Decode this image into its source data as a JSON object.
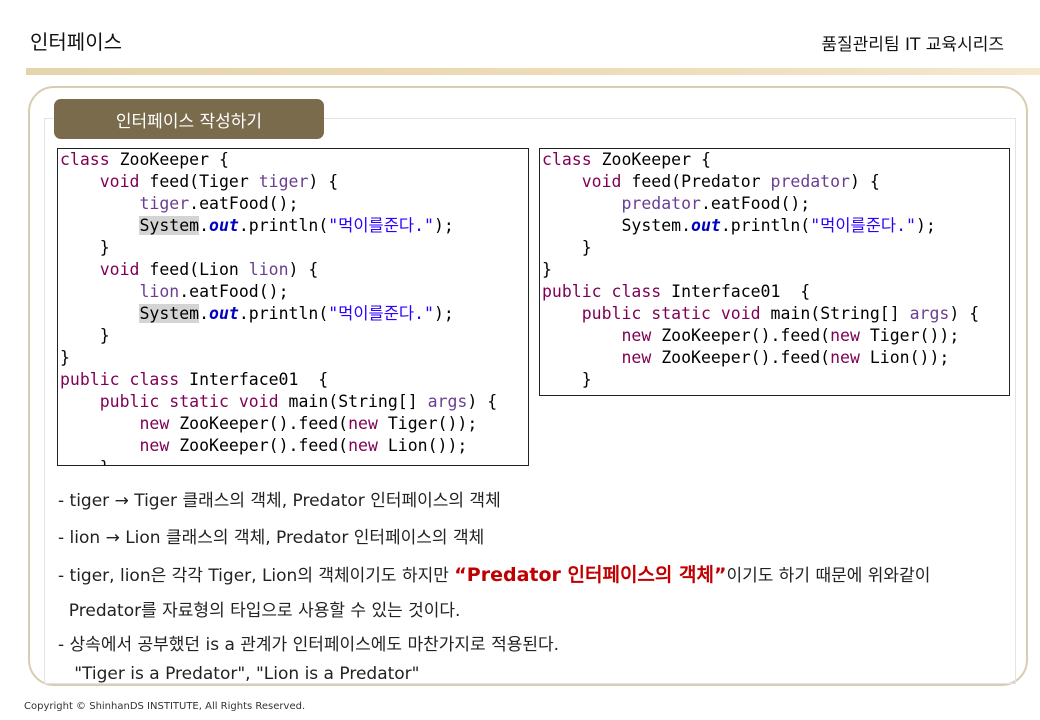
{
  "header": {
    "title": "인터페이스",
    "series": "품질관리팀 IT 교육시리즈"
  },
  "section": {
    "tab_label": "인터페이스 작성하기"
  },
  "code_left": {
    "lines": [
      [
        {
          "t": "class",
          "c": "kw"
        },
        {
          "t": " ZooKeeper {"
        }
      ],
      [
        {
          "t": "    "
        },
        {
          "t": "void",
          "c": "kw"
        },
        {
          "t": " feed(Tiger "
        },
        {
          "t": "tiger",
          "c": "var"
        },
        {
          "t": ") {"
        }
      ],
      [
        {
          "t": "        "
        },
        {
          "t": "tiger",
          "c": "var"
        },
        {
          "t": ".eatFood();"
        }
      ],
      [
        {
          "t": "        "
        },
        {
          "t": "System",
          "c": "hl"
        },
        {
          "t": "."
        },
        {
          "t": "out",
          "c": "field"
        },
        {
          "t": ".println("
        },
        {
          "t": "\"먹이를준다.\"",
          "c": "str"
        },
        {
          "t": ");"
        }
      ],
      [
        {
          "t": "    }"
        }
      ],
      [
        {
          "t": "    "
        },
        {
          "t": "void",
          "c": "kw"
        },
        {
          "t": " feed(Lion "
        },
        {
          "t": "lion",
          "c": "var"
        },
        {
          "t": ") {"
        }
      ],
      [
        {
          "t": "        "
        },
        {
          "t": "lion",
          "c": "var"
        },
        {
          "t": ".eatFood();"
        }
      ],
      [
        {
          "t": "        "
        },
        {
          "t": "System",
          "c": "hl"
        },
        {
          "t": "."
        },
        {
          "t": "out",
          "c": "field"
        },
        {
          "t": ".println("
        },
        {
          "t": "\"먹이를준다.\"",
          "c": "str"
        },
        {
          "t": ");"
        }
      ],
      [
        {
          "t": "    }"
        }
      ],
      [
        {
          "t": "}"
        }
      ],
      [
        {
          "t": "public",
          "c": "kw"
        },
        {
          "t": " "
        },
        {
          "t": "class",
          "c": "kw"
        },
        {
          "t": " Interface01  {"
        }
      ],
      [
        {
          "t": "    "
        },
        {
          "t": "public",
          "c": "kw"
        },
        {
          "t": " "
        },
        {
          "t": "static",
          "c": "kw"
        },
        {
          "t": " "
        },
        {
          "t": "void",
          "c": "kw"
        },
        {
          "t": " main(String[] "
        },
        {
          "t": "args",
          "c": "var"
        },
        {
          "t": ") {"
        }
      ],
      [
        {
          "t": "        "
        },
        {
          "t": "new",
          "c": "kw"
        },
        {
          "t": " ZooKeeper().feed("
        },
        {
          "t": "new",
          "c": "kw"
        },
        {
          "t": " Tiger());"
        }
      ],
      [
        {
          "t": "        "
        },
        {
          "t": "new",
          "c": "kw"
        },
        {
          "t": " ZooKeeper().feed("
        },
        {
          "t": "new",
          "c": "kw"
        },
        {
          "t": " Lion());"
        }
      ],
      [
        {
          "t": "    }"
        }
      ]
    ]
  },
  "code_right": {
    "lines": [
      [
        {
          "t": "class",
          "c": "kw"
        },
        {
          "t": " ZooKeeper {"
        }
      ],
      [
        {
          "t": "    "
        },
        {
          "t": "void",
          "c": "kw"
        },
        {
          "t": " feed(Predator "
        },
        {
          "t": "predator",
          "c": "var"
        },
        {
          "t": ") {"
        }
      ],
      [
        {
          "t": "        "
        },
        {
          "t": "predator",
          "c": "var"
        },
        {
          "t": ".eatFood();"
        }
      ],
      [
        {
          "t": "        System."
        },
        {
          "t": "out",
          "c": "field"
        },
        {
          "t": ".println("
        },
        {
          "t": "\"먹이를준다.\"",
          "c": "str"
        },
        {
          "t": ");"
        }
      ],
      [
        {
          "t": "    }"
        }
      ],
      [
        {
          "t": "}"
        }
      ],
      [
        {
          "t": "public",
          "c": "kw"
        },
        {
          "t": " "
        },
        {
          "t": "class",
          "c": "kw"
        },
        {
          "t": " Interface01  {"
        }
      ],
      [
        {
          "t": "    "
        },
        {
          "t": "public",
          "c": "kw"
        },
        {
          "t": " "
        },
        {
          "t": "static",
          "c": "kw"
        },
        {
          "t": " "
        },
        {
          "t": "void",
          "c": "kw"
        },
        {
          "t": " main(String[] "
        },
        {
          "t": "args",
          "c": "var"
        },
        {
          "t": ") {"
        }
      ],
      [
        {
          "t": "        "
        },
        {
          "t": "new",
          "c": "kw"
        },
        {
          "t": " ZooKeeper().feed("
        },
        {
          "t": "new",
          "c": "kw"
        },
        {
          "t": " Tiger());"
        }
      ],
      [
        {
          "t": "        "
        },
        {
          "t": "new",
          "c": "kw"
        },
        {
          "t": " ZooKeeper().feed("
        },
        {
          "t": "new",
          "c": "kw"
        },
        {
          "t": " Lion());"
        }
      ],
      [
        {
          "t": "    }"
        }
      ]
    ]
  },
  "bullets": {
    "b1": "- tiger → Tiger 클래스의 객체, Predator 인터페이스의 객체",
    "b2": "- lion → Lion 클래스의 객체, Predator 인터페이스의 객체",
    "b3_pre": "- tiger, lion은 각각 Tiger, Lion의 객체이기도 하지만 ",
    "b3_emph": "“Predator 인터페이스의 객체”",
    "b3_post": "이기도 하기 때문에 위와같이",
    "b4": "  Predator를 자료형의 타입으로 사용할 수 있는 것이다.",
    "b5": "- 상속에서 공부했던 is a 관계가 인터페이스에도 마찬가지로 적용된다.",
    "b6": "   \"Tiger is a Predator\", \"Lion is a Predator\""
  },
  "footer": {
    "copyright": "Copyright © ShinhanDS INSTITUTE, All Rights Reserved."
  },
  "colors": {
    "tab_bg": "#7a6b4c",
    "header_bar": "#e6d4ad",
    "frame_border": "#d8cdb0",
    "keyword": "#7f0055",
    "variable": "#6a3e92",
    "string": "#2a00ff",
    "field": "#0000c0",
    "emphasis": "#c00000"
  }
}
